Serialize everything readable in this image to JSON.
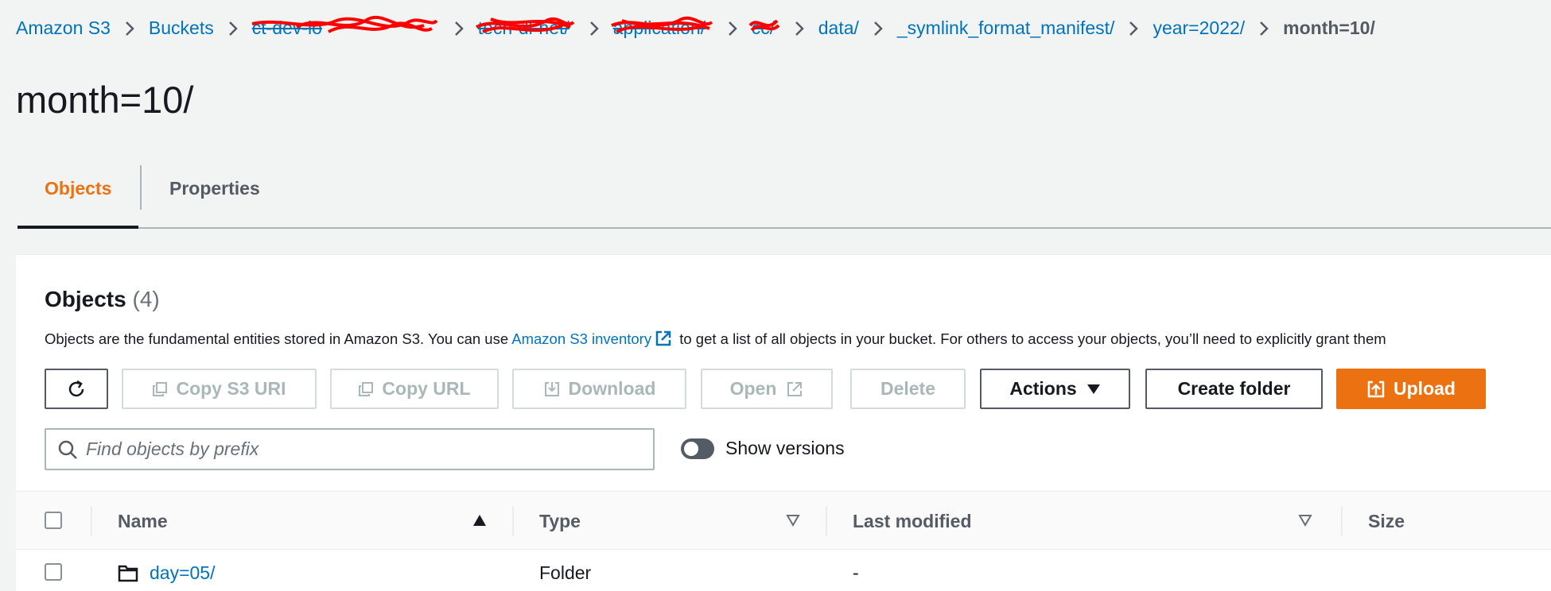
{
  "breadcrumb": {
    "items": [
      {
        "label": "Amazon S3",
        "redacted": false
      },
      {
        "label": "Buckets",
        "redacted": false
      },
      {
        "label": "ct-dev-lo",
        "redacted": true
      },
      {
        "label": "tech-dl-net/",
        "redacted": true
      },
      {
        "label": "application/",
        "redacted": true
      },
      {
        "label": "cc/",
        "redacted": true
      },
      {
        "label": "data/",
        "redacted": false
      },
      {
        "label": "_symlink_format_manifest/",
        "redacted": false
      },
      {
        "label": "year=2022/",
        "redacted": false
      },
      {
        "label": "month=10/",
        "redacted": false,
        "current": true
      }
    ]
  },
  "page": {
    "title": "month=10/"
  },
  "tabs": [
    {
      "label": "Objects",
      "active": true
    },
    {
      "label": "Properties",
      "active": false
    }
  ],
  "objects": {
    "heading": "Objects",
    "count": "(4)",
    "description_pre": "Objects are the fundamental entities stored in Amazon S3. You can use ",
    "description_link": "Amazon S3 inventory",
    "description_post": " to get a list of all objects in your bucket. For others to access your objects, you’ll need to explicitly grant them"
  },
  "toolbar": {
    "refresh_icon": "refresh-icon",
    "copy_s3_uri": "Copy S3 URI",
    "copy_url": "Copy URL",
    "download": "Download",
    "open": "Open",
    "delete": "Delete",
    "actions": "Actions",
    "create_folder": "Create folder",
    "upload": "Upload"
  },
  "search": {
    "placeholder": "Find objects by prefix"
  },
  "versions_toggle": {
    "label": "Show versions",
    "on": false
  },
  "table": {
    "columns": [
      "Name",
      "Type",
      "Last modified",
      "Size"
    ],
    "rows": [
      {
        "name": "day=05/",
        "type": "Folder",
        "last_modified": "-",
        "size": ""
      }
    ]
  },
  "colors": {
    "accent": "#ec7211",
    "link": "#0073bb",
    "redaction": "#ff0000"
  }
}
